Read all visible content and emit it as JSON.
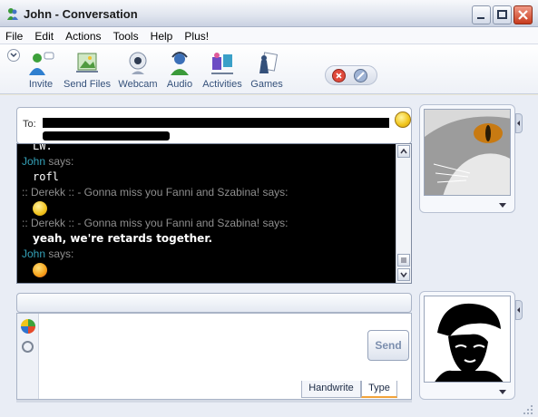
{
  "window": {
    "title": "John - Conversation"
  },
  "menu": [
    "File",
    "Edit",
    "Actions",
    "Tools",
    "Help",
    "Plus!"
  ],
  "toolbar": {
    "items": [
      {
        "label": "Invite",
        "icon": "invite-icon"
      },
      {
        "label": "Send Files",
        "icon": "send-files-icon"
      },
      {
        "label": "Webcam",
        "icon": "webcam-icon"
      },
      {
        "label": "Audio",
        "icon": "audio-icon"
      },
      {
        "label": "Activities",
        "icon": "activities-icon"
      },
      {
        "label": "Games",
        "icon": "games-icon"
      }
    ]
  },
  "to_field": {
    "label": "To:"
  },
  "conversation": {
    "lines": [
      {
        "kind": "msg",
        "text": "LW."
      },
      {
        "kind": "sender",
        "name": "John",
        "suffix": "says:"
      },
      {
        "kind": "msg",
        "text": "rofl"
      },
      {
        "kind": "sender-grey",
        "name": ":: Derekk :: - Gonna miss you Fanni and Szabina! says:"
      },
      {
        "kind": "emoticon",
        "icon": "wink-emoticon"
      },
      {
        "kind": "sender-grey",
        "name": ":: Derekk :: - Gonna miss you Fanni and Szabina! says:"
      },
      {
        "kind": "msg-bold",
        "text": "yeah, we're retards together."
      },
      {
        "kind": "sender",
        "name": "John",
        "suffix": "says:"
      },
      {
        "kind": "emoticon",
        "icon": "tongue-emoticon"
      }
    ]
  },
  "input": {
    "send_label": "Send",
    "tabs": [
      "Handwrite",
      "Type"
    ],
    "active_tab": "Type"
  },
  "colors": {
    "sender_name": "#34a1b8",
    "sender_grey": "#8f8f8f",
    "chat_background": "#000000",
    "active_tab_accent": "#f2a33a"
  }
}
